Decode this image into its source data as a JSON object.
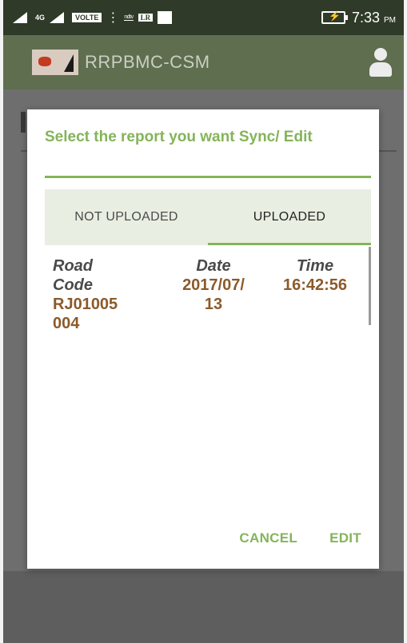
{
  "statusbar": {
    "network_label": "4G",
    "network_sub": "R",
    "volte": "VOLTE",
    "dots": "⋮",
    "ndtv": "ndtv",
    "lr": "LR",
    "time": "7:33",
    "ampm": "PM"
  },
  "appbar": {
    "title": "RRPBMC-CSM"
  },
  "dialog": {
    "title": "Select the report you want Sync/ Edit",
    "tabs": [
      {
        "label": "NOT UPLOADED",
        "selected": false
      },
      {
        "label": "UPLOADED",
        "selected": true
      }
    ],
    "columns": {
      "road_header_1": "Road",
      "road_header_2": "Code",
      "road_value_1": "RJ01005",
      "road_value_2": "004",
      "date_header": "Date",
      "date_value_1": "2017/07/",
      "date_value_2": "13",
      "time_header": "Time",
      "time_value": "16:42:56"
    },
    "buttons": {
      "cancel": "CANCEL",
      "edit": "EDIT"
    }
  },
  "colors": {
    "accent": "#84b45a",
    "value_text": "#8b5a2b",
    "appbar": "#5f6e4f",
    "statusbar": "#2f3a28"
  }
}
